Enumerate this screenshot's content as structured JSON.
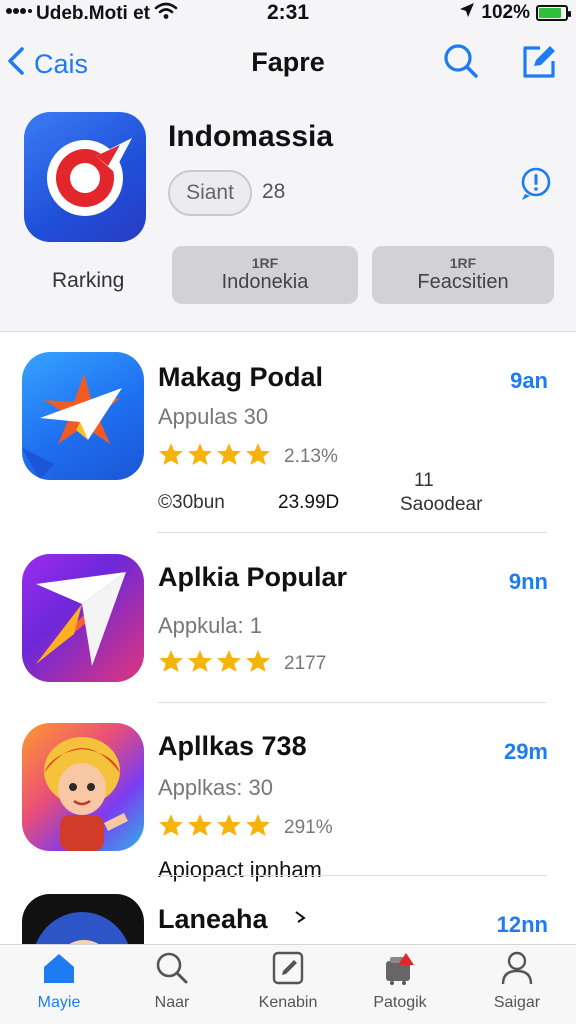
{
  "status_bar": {
    "carrier": "Udeb.Moti et",
    "time": "2:31",
    "battery_text": "102%",
    "battery_level": 0.85
  },
  "nav": {
    "back_label": "Cais",
    "title": "Fapre"
  },
  "header": {
    "app_name": "Indomassia",
    "pill_label": "Siant",
    "pill_count": "28",
    "ranking_label": "Rarking",
    "rank_buttons": [
      {
        "small": "1RF",
        "label": "Indonekia"
      },
      {
        "small": "1RF",
        "label": "Feacsitien"
      }
    ]
  },
  "list": {
    "items": [
      {
        "title": "Makag Podal",
        "subtitle": "Appulas 30",
        "rating": 4,
        "rating_count": "2.13%",
        "size": "9an",
        "meta": [
          "©30bun",
          "23.99D",
          "11",
          "Saoodear"
        ]
      },
      {
        "title": "Aplkia Popular",
        "subtitle": "Appkula: 1",
        "rating": 4,
        "rating_count": "2177",
        "size": "9nn"
      },
      {
        "title": "Apllkas 738",
        "subtitle": "Applkas: 30",
        "rating": 4,
        "rating_count": "291%",
        "size": "29m",
        "footer": "Apiopact ipnham"
      },
      {
        "title": "Laneaha",
        "size": "12nn"
      }
    ]
  },
  "tabbar": {
    "tabs": [
      {
        "label": "Mayie",
        "icon": "home-icon",
        "active": true
      },
      {
        "label": "Naar",
        "icon": "search-icon",
        "active": false
      },
      {
        "label": "Kenabin",
        "icon": "edit-icon",
        "active": false
      },
      {
        "label": "Patogik",
        "icon": "cart-icon",
        "active": false
      },
      {
        "label": "Saigar",
        "icon": "person-icon",
        "active": false
      }
    ]
  },
  "colors": {
    "accent": "#1e7cf2",
    "star": "#f6b30a",
    "background": "#f5f5f7"
  }
}
